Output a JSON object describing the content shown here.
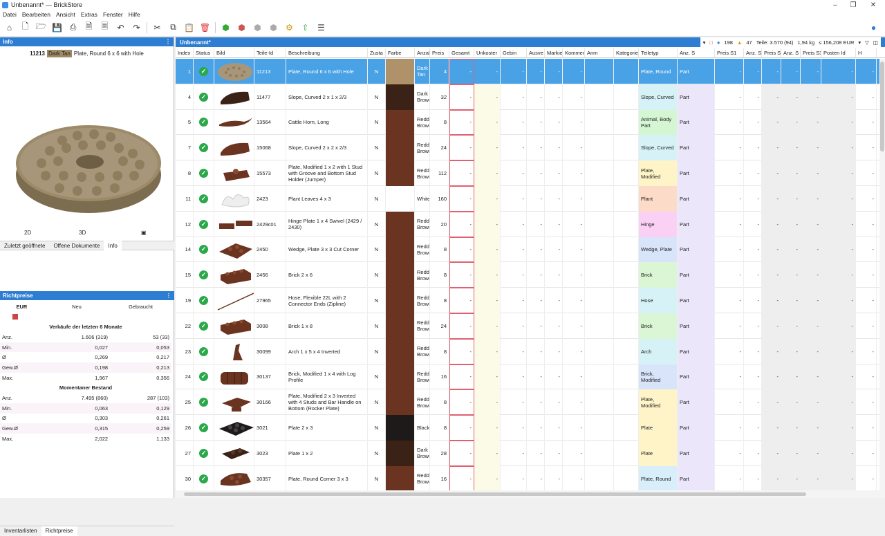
{
  "window": {
    "title": "Unbenannt* — BrickStore"
  },
  "menu": [
    "Datei",
    "Bearbeiten",
    "Ansicht",
    "Extras",
    "Fenster",
    "Hilfe"
  ],
  "info_panel": {
    "header": "Info",
    "part_id": "11213",
    "color": "Dark Tan",
    "name": "Plate, Round 6 x 6 with Hole",
    "view_2d": "2D",
    "view_3d": "3D"
  },
  "tabs_top": [
    "Zuletzt geöffnete",
    "Offene Dokumente",
    "Info"
  ],
  "prices": {
    "header": "Richtpreise",
    "currency": "EUR",
    "col_new": "Neu",
    "col_used": "Gebraucht",
    "section1": "Verkäufe der letzten 6 Monate",
    "rows1": [
      {
        "label": "Anz.",
        "new": "1.606 (319)",
        "used": "53 (33)"
      },
      {
        "label": "Min.",
        "new": "0,027",
        "used": "0,053"
      },
      {
        "label": "Ø",
        "new": "0,269",
        "used": "0,217"
      },
      {
        "label": "Gew.Ø",
        "new": "0,198",
        "used": "0,213"
      },
      {
        "label": "Max.",
        "new": "1,967",
        "used": "0,356"
      }
    ],
    "section2": "Momentaner Bestand",
    "rows2": [
      {
        "label": "Anz.",
        "new": "7.495 (860)",
        "used": "287 (103)"
      },
      {
        "label": "Min.",
        "new": "0,063",
        "used": "0,129"
      },
      {
        "label": "Ø",
        "new": "0,303",
        "used": "0,261"
      },
      {
        "label": "Gew.Ø",
        "new": "0,315",
        "used": "0,259"
      },
      {
        "label": "Max.",
        "new": "2,022",
        "used": "1,133"
      }
    ]
  },
  "tabs_bottom": [
    "Inventarlisten",
    "Richtpreise"
  ],
  "document": {
    "title": "Unbenannt*",
    "status": {
      "lots": "198",
      "errors": "47",
      "parts": "Teile: 3.570 (94)",
      "weight": "1,94 kg",
      "total": "≤ 156,208  EUR"
    }
  },
  "columns": [
    "Index",
    "Status",
    "Bild",
    "Teile-Id",
    "Beschreibung",
    "Zusta",
    "Farbe",
    "Anzah",
    "Preis",
    "Gesamt",
    "Unkoster",
    "Gebin",
    "Ausve",
    "Markieru",
    "Kommen",
    "Anm",
    "Kategorie",
    "Teiletyp",
    "Anz. S",
    "Preis S1",
    "Anz. S",
    "Preis S2",
    "Anz. S",
    "Preis S3",
    "Posten Id",
    "H"
  ],
  "colors": {
    "accent": "#2d7dd2",
    "selection": "#4aa2e6",
    "ok": "#2aa84a"
  },
  "rows": [
    {
      "idx": "1",
      "id": "11213",
      "desc": "Plate, Round 6 x 6 with Hole",
      "cond": "N",
      "color": "Dark Tan",
      "qty": "4",
      "cat": "Plate, Round",
      "type": "Part",
      "swatch": "#b0926a",
      "catbg": "#d8eefa",
      "sel": true,
      "icon": "round-plate"
    },
    {
      "idx": "4",
      "id": "11477",
      "desc": "Slope, Curved 2 x 1 x 2/3",
      "cond": "N",
      "color": "Dark Brown",
      "qty": "32",
      "cat": "Slope, Curved",
      "type": "Part",
      "swatch": "#3a2217",
      "catbg": "#d6f2f6",
      "icon": "slope"
    },
    {
      "idx": "5",
      "id": "13564",
      "desc": "Cattle Horn, Long",
      "cond": "N",
      "color": "Reddish Brown",
      "qty": "8",
      "cat": "Animal, Body Part",
      "type": "Part",
      "swatch": "#6b3420",
      "catbg": "#d4f6d2",
      "icon": "horn"
    },
    {
      "idx": "7",
      "id": "15068",
      "desc": "Slope, Curved 2 x 2 x 2/3",
      "cond": "N",
      "color": "Reddish Brown",
      "qty": "24",
      "cat": "Slope, Curved",
      "type": "Part",
      "swatch": "#6b3420",
      "catbg": "#d6f2f6",
      "icon": "slope"
    },
    {
      "idx": "8",
      "id": "15573",
      "desc": "Plate, Modified 1 x 2 with 1 Stud with Groove and Bottom Stud Holder (Jumper)",
      "cond": "N",
      "color": "Reddish Brown",
      "qty": "112",
      "cat": "Plate, Modified",
      "type": "Part",
      "swatch": "#6b3420",
      "catbg": "#fff4c8",
      "icon": "jumper"
    },
    {
      "idx": "11",
      "id": "2423",
      "desc": "Plant Leaves 4 x 3",
      "cond": "N",
      "color": "White",
      "qty": "160",
      "cat": "Plant",
      "type": "Part",
      "swatch": "#ffffff",
      "catbg": "#fcdcc8",
      "icon": "leaves"
    },
    {
      "idx": "12",
      "id": "2429c01",
      "desc": "Hinge Plate 1 x 4 Swivel (2429 / 2430)",
      "cond": "N",
      "color": "Reddish Brown",
      "qty": "20",
      "cat": "Hinge",
      "type": "Part",
      "swatch": "#6b3420",
      "catbg": "#fad0f4",
      "icon": "hinge"
    },
    {
      "idx": "14",
      "id": "2450",
      "desc": "Wedge, Plate 3 x 3 Cut Corner",
      "cond": "N",
      "color": "Reddish Brown",
      "qty": "8",
      "cat": "Wedge, Plate",
      "type": "Part",
      "swatch": "#6b3420",
      "catbg": "#d8e4fa",
      "icon": "wedge"
    },
    {
      "idx": "15",
      "id": "2456",
      "desc": "Brick 2 x 6",
      "cond": "N",
      "color": "Reddish Brown",
      "qty": "8",
      "cat": "Brick",
      "type": "Part",
      "swatch": "#6b3420",
      "catbg": "#daf6d4",
      "icon": "brick"
    },
    {
      "idx": "19",
      "id": "27965",
      "desc": "Hose, Flexible 22L with 2 Connector Ends (Zipline)",
      "cond": "N",
      "color": "Reddish Brown",
      "qty": "8",
      "cat": "Hose",
      "type": "Part",
      "swatch": "#6b3420",
      "catbg": "#d6f2f6",
      "icon": "hose"
    },
    {
      "idx": "22",
      "id": "3008",
      "desc": "Brick 1 x 8",
      "cond": "N",
      "color": "Reddish Brown",
      "qty": "24",
      "cat": "Brick",
      "type": "Part",
      "swatch": "#6b3420",
      "catbg": "#daf6d4",
      "icon": "brick"
    },
    {
      "idx": "23",
      "id": "30099",
      "desc": "Arch 1 x 5 x 4 Inverted",
      "cond": "N",
      "color": "Reddish Brown",
      "qty": "8",
      "cat": "Arch",
      "type": "Part",
      "swatch": "#6b3420",
      "catbg": "#d6f2f6",
      "icon": "arch"
    },
    {
      "idx": "24",
      "id": "30137",
      "desc": "Brick, Modified 1 x 4 with Log Profile",
      "cond": "N",
      "color": "Reddish Brown",
      "qty": "16",
      "cat": "Brick, Modified",
      "type": "Part",
      "swatch": "#6b3420",
      "catbg": "#d8e4fa",
      "icon": "log"
    },
    {
      "idx": "25",
      "id": "30166",
      "desc": "Plate, Modified 2 x 3 Inverted with 4 Studs and Bar Handle on Bottom (Rocker Plate)",
      "cond": "N",
      "color": "Reddish Brown",
      "qty": "8",
      "cat": "Plate, Modified",
      "type": "Part",
      "swatch": "#6b3420",
      "catbg": "#fff4c8",
      "icon": "rocker"
    },
    {
      "idx": "26",
      "id": "3021",
      "desc": "Plate 2 x 3",
      "cond": "N",
      "color": "Black",
      "qty": "8",
      "cat": "Plate",
      "type": "Part",
      "swatch": "#1e1a1a",
      "catbg": "#fff4c8",
      "icon": "plate-black"
    },
    {
      "idx": "27",
      "id": "3023",
      "desc": "Plate 1 x 2",
      "cond": "N",
      "color": "Dark Brown",
      "qty": "28",
      "cat": "Plate",
      "type": "Part",
      "swatch": "#3a2217",
      "catbg": "#fff4c8",
      "icon": "plate"
    },
    {
      "idx": "30",
      "id": "30357",
      "desc": "Plate, Round Corner 3 x 3",
      "cond": "N",
      "color": "Reddish Brown",
      "qty": "16",
      "cat": "Plate, Round",
      "type": "Part",
      "swatch": "#6b3420",
      "catbg": "#d8eefa",
      "icon": "corner"
    }
  ]
}
